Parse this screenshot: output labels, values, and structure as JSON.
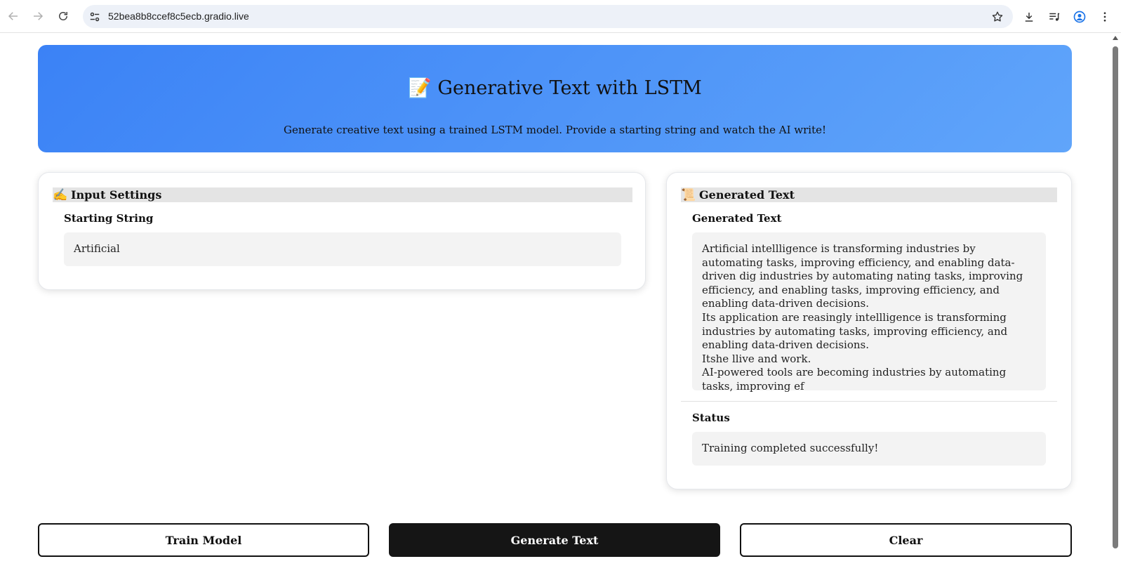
{
  "browser": {
    "url": "52bea8b8ccef8c5ecb.gradio.live"
  },
  "banner": {
    "title_emoji": "📝",
    "title": "Generative Text with LSTM",
    "subtitle": "Generate creative text using a trained LSTM model. Provide a starting string and watch the AI write!",
    "gradient_start": "#3b82f6",
    "gradient_end": "#60a5fa"
  },
  "input_panel": {
    "header_emoji": "✍️",
    "header": "Input Settings",
    "starting_string_label": "Starting String",
    "starting_string_value": "Artificial"
  },
  "output_panel": {
    "header_emoji": "📜",
    "header": "Generated Text",
    "generated_label": "Generated Text",
    "generated_value": "Artificial intellligence is transforming industries by automating tasks, improving efficiency, and enabling data-driven dig industries by automating nating tasks, improving efficiency, and enabling tasks, improving efficiency, and enabling data-driven decisions.\nIts application are reasingly intellligence is transforming industries by automating tasks, improving efficiency, and enabling data-driven decisions.\nItshe llive and work.\nAI-powered tools are becoming industries by automating tasks, improving ef",
    "status_label": "Status",
    "status_value": "Training completed successfully!"
  },
  "buttons": {
    "train": "Train Model",
    "generate": "Generate Text",
    "clear": "Clear"
  }
}
